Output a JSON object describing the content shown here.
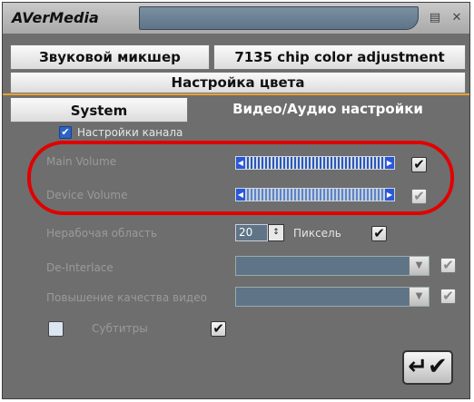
{
  "app": {
    "logo": "AVerMedia"
  },
  "titlebar": {
    "menu_icon": "▤",
    "close_icon": "✕"
  },
  "tabs": {
    "audio_mixer": "Звуковой микшер",
    "chip_color": "7135 chip color adjustment",
    "color_settings": "Настройка цвета",
    "system": "System",
    "video_audio": "Видео/Аудио настройки"
  },
  "channel": {
    "label": "Настройки канала",
    "checked": true
  },
  "volume": {
    "main_label": "Main Volume",
    "device_label": "Device Volume"
  },
  "nonwork": {
    "label": "Нерабочая область",
    "value": "20",
    "unit": "Пиксель"
  },
  "deinterlace": {
    "label": "De-Interlace"
  },
  "enhance": {
    "label": "Повышение качества видео"
  },
  "subtitles": {
    "label": "Субтитры"
  },
  "glyphs": {
    "check": "✔",
    "left": "◀",
    "right": "▶",
    "down": "▼",
    "spin": "↕",
    "ok": "↵✔"
  }
}
